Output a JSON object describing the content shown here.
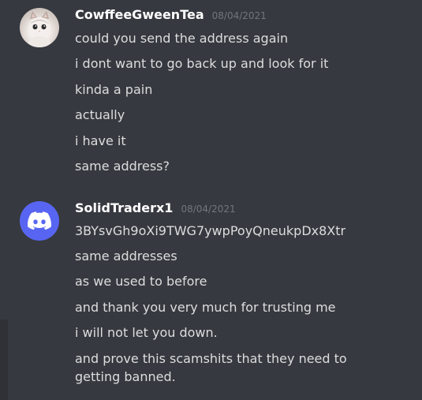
{
  "messages": [
    {
      "username": "CowffeeGweenTea",
      "timestamp": "08/04/2021",
      "avatar_icon": "kitten-avatar",
      "lines": [
        "could you send the address again",
        "i dont want to go back up and look for it",
        "kinda a pain",
        "actually",
        "i have it",
        "same address?"
      ]
    },
    {
      "username": "SolidTraderx1",
      "timestamp": "08/04/2021",
      "avatar_icon": "discord-logo-icon",
      "lines": [
        "3BYsvGh9oXi9TWG7ywpPoyQneukpDx8Xtr",
        "same addresses",
        "as we used to before",
        "and thank you very much for trusting me",
        "i will not let you down.",
        "and prove this scamshits that they need to getting banned."
      ]
    }
  ],
  "colors": {
    "background": "#36393f",
    "username": "#ffffff",
    "timestamp": "#72767d",
    "message_text": "#dcddde",
    "discord_blurple": "#5865f2"
  }
}
